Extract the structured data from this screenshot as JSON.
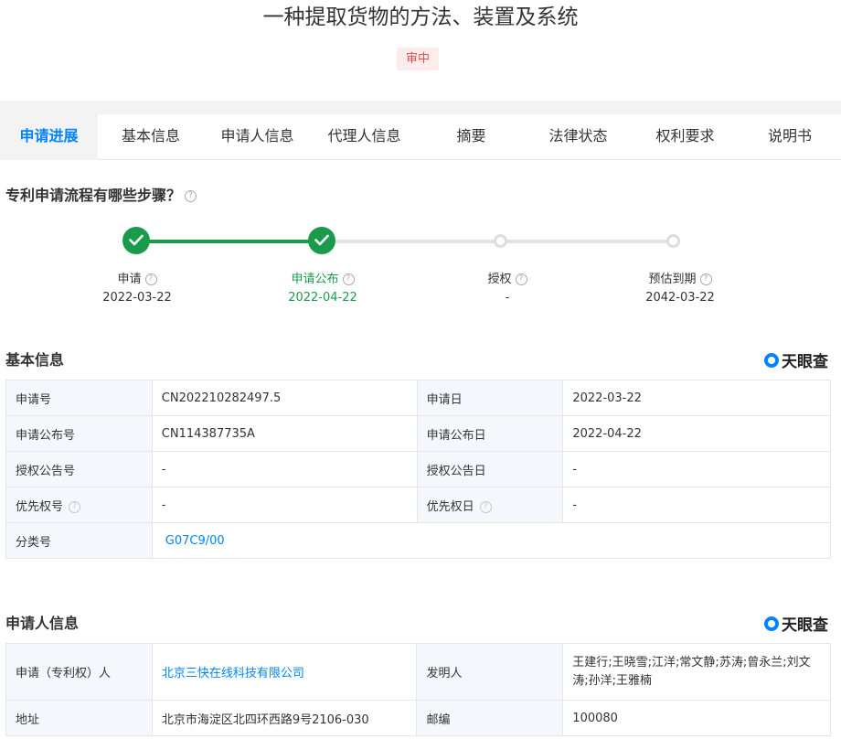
{
  "title": "一种提取货物的方法、装置及系统",
  "status": "审中",
  "tabs": [
    "申请进展",
    "基本信息",
    "申请人信息",
    "代理人信息",
    "摘要",
    "法律状态",
    "权利要求",
    "说明书"
  ],
  "process": {
    "heading": "专利申请流程有哪些步骤？",
    "steps": [
      {
        "label": "申请",
        "date": "2022-03-22",
        "done": true
      },
      {
        "label": "申请公布",
        "date": "2022-04-22",
        "done": true
      },
      {
        "label": "授权",
        "date": "-",
        "done": false
      },
      {
        "label": "预估到期",
        "date": "2042-03-22",
        "done": false
      }
    ]
  },
  "brand": "天眼查",
  "basic": {
    "heading": "基本信息",
    "app_no_label": "申请号",
    "app_no": "CN202210282497.5",
    "app_date_label": "申请日",
    "app_date": "2022-03-22",
    "pub_no_label": "申请公布号",
    "pub_no": "CN114387735A",
    "pub_date_label": "申请公布日",
    "pub_date": "2022-04-22",
    "grant_no_label": "授权公告号",
    "grant_no": "-",
    "grant_date_label": "授权公告日",
    "grant_date": "-",
    "priority_no_label": "优先权号",
    "priority_no": "-",
    "priority_date_label": "优先权日",
    "priority_date": "-",
    "class_label": "分类号",
    "class_value": "G07C9/00"
  },
  "applicant": {
    "heading": "申请人信息",
    "holder_label": "申请（专利权）人",
    "holder": "北京三快在线科技有限公司",
    "inventor_label": "发明人",
    "inventors": "王建行;王晓雪;江洋;常文静;苏涛;曾永兰;刘文涛;孙洋;王雅楠",
    "address_label": "地址",
    "address": "北京市海淀区北四环西路9号2106-030",
    "postcode_label": "邮编",
    "postcode": "100080"
  }
}
